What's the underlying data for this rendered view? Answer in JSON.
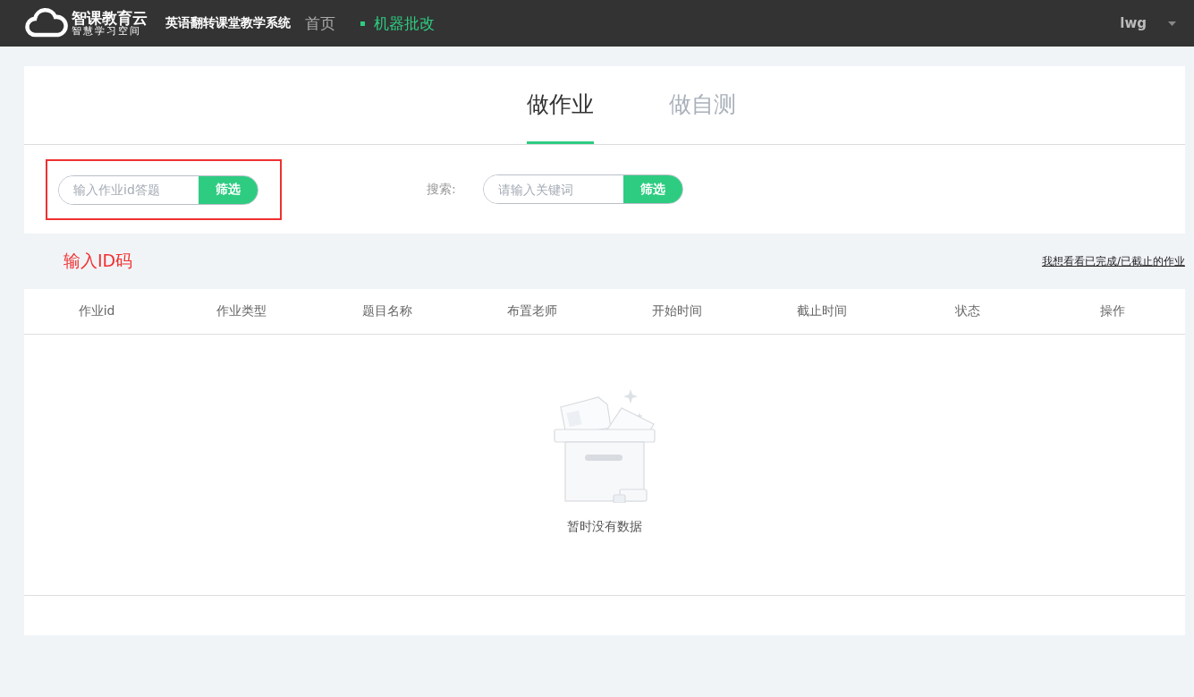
{
  "header": {
    "logo_title": "智课教育云",
    "logo_subtitle": "智慧学习空间",
    "system_name": "英语翻转课堂教学系统",
    "nav": [
      {
        "label": "首页",
        "selected": false
      },
      {
        "label": "机器批改",
        "selected": true
      }
    ],
    "user": "lwg"
  },
  "tabs": [
    {
      "label": "做作业",
      "selected": true
    },
    {
      "label": "做自测",
      "selected": false
    }
  ],
  "id_filter": {
    "placeholder": "输入作业id答题",
    "button": "筛选",
    "highlighted": true
  },
  "search": {
    "label": "搜索:",
    "placeholder": "请输入关键词",
    "button": "筛选"
  },
  "annotation": "输入ID码",
  "finished_link": "我想看看已完成/已截止的作业",
  "table": {
    "columns": [
      "作业id",
      "作业类型",
      "题目名称",
      "布置老师",
      "开始时间",
      "截止时间",
      "状态",
      "操作"
    ],
    "empty_text": "暂时没有数据"
  }
}
